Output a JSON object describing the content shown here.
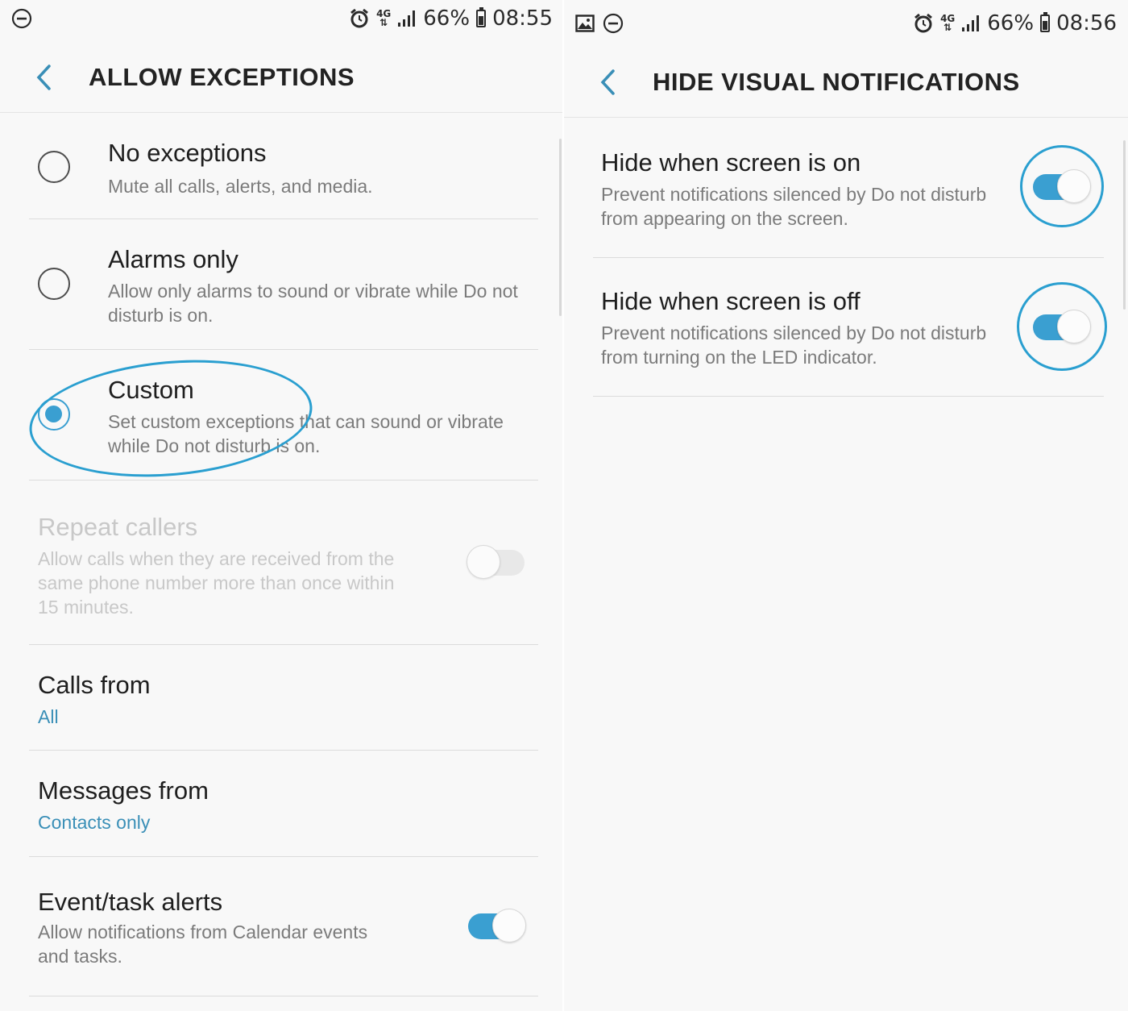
{
  "colors": {
    "accent": "#3a9fd1",
    "highlight_annotation": "#2a9fd0",
    "background": "#f8f8f8",
    "disabled_text": "#c8c8c8"
  },
  "left_screen": {
    "status_bar": {
      "left_icons": [
        "do-not-disturb-icon"
      ],
      "right_icons": [
        "alarm-icon",
        "4g-icon",
        "signal-icon",
        "battery-icon"
      ],
      "network": "4G",
      "battery": "66%",
      "time": "08:55"
    },
    "app_bar": {
      "title": "ALLOW EXCEPTIONS",
      "back_icon": "chevron-left-icon"
    },
    "options": [
      {
        "title": "No exceptions",
        "subtitle": "Mute all calls, alerts, and media.",
        "selected": false
      },
      {
        "title": "Alarms only",
        "subtitle": "Allow only alarms to sound or vibrate while Do not disturb is on.",
        "selected": false
      },
      {
        "title": "Custom",
        "subtitle": "Set custom exceptions that can sound or vibrate while Do not disturb is on.",
        "selected": true
      }
    ],
    "repeat_callers": {
      "title": "Repeat callers",
      "subtitle": "Allow calls when they are received from the same phone number more than once within 15 minutes.",
      "enabled": false,
      "toggle": "off"
    },
    "calls_from": {
      "title": "Calls from",
      "value": "All"
    },
    "messages_from": {
      "title": "Messages from",
      "value": "Contacts only"
    },
    "event_task_alerts": {
      "title": "Event/task alerts",
      "subtitle": "Allow notifications from Calendar events and tasks.",
      "toggle": "on"
    }
  },
  "right_screen": {
    "status_bar": {
      "left_icons": [
        "image-icon",
        "do-not-disturb-icon"
      ],
      "right_icons": [
        "alarm-icon",
        "4g-icon",
        "signal-icon",
        "battery-icon"
      ],
      "network": "4G",
      "battery": "66%",
      "time": "08:56"
    },
    "app_bar": {
      "title": "HIDE VISUAL NOTIFICATIONS",
      "back_icon": "chevron-left-icon"
    },
    "items": [
      {
        "title": "Hide when screen is on",
        "subtitle": "Prevent notifications silenced by Do not disturb from appearing on the screen.",
        "toggle": "on"
      },
      {
        "title": "Hide when screen is off",
        "subtitle": "Prevent notifications silenced by Do not disturb from turning on the LED indicator.",
        "toggle": "on"
      }
    ]
  }
}
